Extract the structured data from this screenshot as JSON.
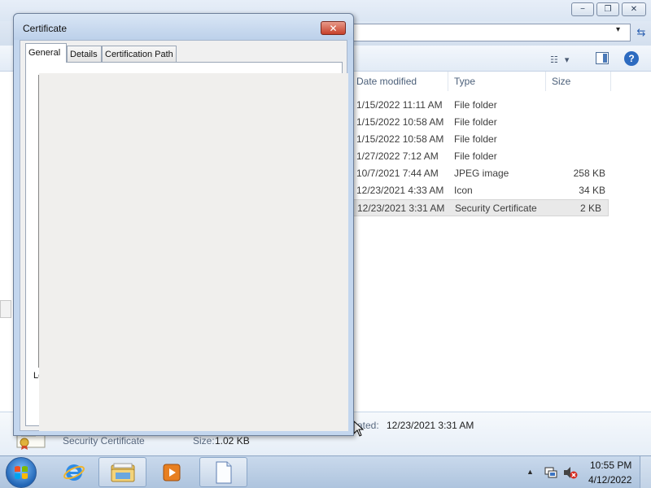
{
  "explorer": {
    "window_buttons": {
      "minimize": "−",
      "maximize": "❐",
      "close": "✕"
    },
    "address_dropdown": "▾",
    "refresh_icon": "refresh-icon",
    "columns": {
      "date": "Date modified",
      "type": "Type",
      "size": "Size"
    },
    "files": [
      {
        "date": "1/15/2022 11:11 AM",
        "type": "File folder",
        "size": ""
      },
      {
        "date": "1/15/2022 10:58 AM",
        "type": "File folder",
        "size": ""
      },
      {
        "date": "1/15/2022 10:58 AM",
        "type": "File folder",
        "size": ""
      },
      {
        "date": "1/27/2022 7:12 AM",
        "type": "File folder",
        "size": ""
      },
      {
        "date": "10/7/2021 7:44 AM",
        "type": "JPEG image",
        "size": "258 KB"
      },
      {
        "date": "12/23/2021 4:33 AM",
        "type": "Icon",
        "size": "34 KB"
      },
      {
        "date": "12/23/2021 3:31 AM",
        "type": "Security Certificate",
        "size": "2 KB",
        "selected": true
      }
    ],
    "details": {
      "name": "Security Certificate",
      "size_label": "Size:",
      "size_value": "1.02 KB",
      "created_label": "ated:",
      "created_value": "12/23/2021 3:31 AM"
    },
    "help_label": "?"
  },
  "cert_dialog": {
    "title": "Certificate",
    "close_label": "✕",
    "tabs": [
      {
        "label": "General",
        "active": true
      },
      {
        "label": "Details",
        "active": false
      },
      {
        "label": "Certification Path",
        "active": false
      }
    ],
    "partial_label": "Le"
  },
  "taskbar": {
    "clock_time": "10:55 PM",
    "clock_date": "4/12/2022",
    "tray_chevron": "▲"
  },
  "colors": {
    "accent": "#2d6bc0",
    "selected_row": "#e9e9e9",
    "dialog_frame": "#c3d6ee"
  }
}
